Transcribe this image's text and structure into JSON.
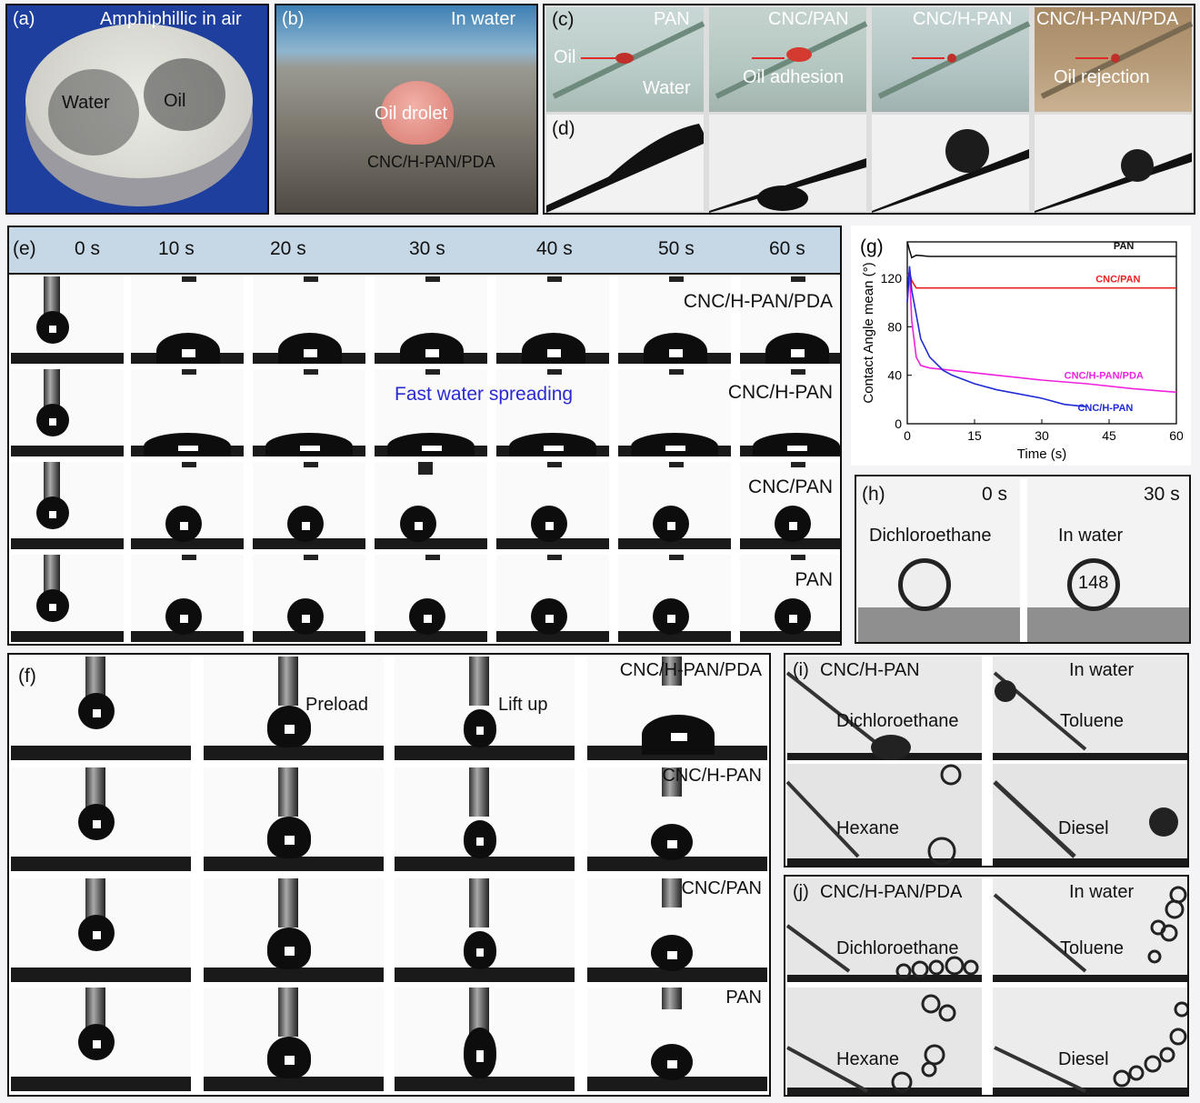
{
  "panels": {
    "a": {
      "label": "(a)",
      "title": "Amphiphillic in air",
      "water": "Water",
      "oil": "Oil"
    },
    "b": {
      "label": "(b)",
      "title": "In water",
      "droplet": "Oil drolet",
      "material": "CNC/H-PAN/PDA"
    },
    "c": {
      "label": "(c)",
      "titles": [
        "PAN",
        "CNC/PAN",
        "CNC/H-PAN",
        "CNC/H-PAN/PDA"
      ],
      "oil": "Oil",
      "water": "Water",
      "adhesion": "Oil adhesion",
      "rejection": "Oil rejection"
    },
    "d": {
      "label": "(d)"
    },
    "e": {
      "label": "(e)",
      "times": [
        "0 s",
        "10 s",
        "20 s",
        "30 s",
        "40 s",
        "50 s",
        "60 s"
      ],
      "rows": [
        "CNC/H-PAN/PDA",
        "CNC/H-PAN",
        "CNC/PAN",
        "PAN"
      ],
      "note": "Fast water spreading"
    },
    "f": {
      "label": "(f)",
      "rows": [
        "CNC/H-PAN/PDA",
        "CNC/H-PAN",
        "CNC/PAN",
        "PAN"
      ],
      "preload": "Preload",
      "liftup": "Lift up"
    },
    "h": {
      "label": "(h)",
      "t0": "0 s",
      "t30": "30 s",
      "left": "Dichloroethane",
      "right": "In water",
      "angle": "148"
    },
    "i": {
      "label": "(i)",
      "material": "CNC/H-PAN",
      "env": "In water",
      "oils": [
        "Dichloroethane",
        "Toluene",
        "Hexane",
        "Diesel"
      ]
    },
    "j": {
      "label": "(j)",
      "material": "CNC/H-PAN/PDA",
      "env": "In water",
      "oils": [
        "Dichloroethane",
        "Toluene",
        "Hexane",
        "Diesel"
      ]
    }
  },
  "chart_data": {
    "label": "(g)",
    "type": "line",
    "xlabel": "Time (s)",
    "ylabel": "Contact Angle mean (°)",
    "xlim": [
      0,
      60
    ],
    "ylim": [
      0,
      150
    ],
    "xticks": [
      0,
      15,
      30,
      45,
      60
    ],
    "yticks": [
      0,
      40,
      80,
      120
    ],
    "series": [
      {
        "name": "PAN",
        "color": "#111111",
        "x": [
          0,
          0.5,
          1,
          2,
          5,
          10,
          20,
          30,
          40,
          50,
          60
        ],
        "y": [
          150,
          143,
          137,
          139,
          138,
          138,
          138,
          138,
          138,
          138,
          138
        ]
      },
      {
        "name": "CNC/PAN",
        "color": "#e8231f",
        "x": [
          0,
          0.5,
          1,
          2,
          3,
          10,
          20,
          30,
          40,
          50,
          60
        ],
        "y": [
          122,
          125,
          118,
          112,
          112,
          112,
          112,
          112,
          112,
          112,
          112
        ]
      },
      {
        "name": "CNC/H-PAN/PDA",
        "color": "#ee22dd",
        "x": [
          0,
          0.5,
          1,
          2,
          3,
          5,
          10,
          20,
          30,
          40,
          50,
          60
        ],
        "y": [
          100,
          125,
          85,
          55,
          48,
          46,
          44,
          40,
          36,
          33,
          29,
          26
        ]
      },
      {
        "name": "CNC/H-PAN",
        "color": "#1f2bd6",
        "x": [
          0,
          0.5,
          1,
          2,
          3,
          5,
          8,
          10,
          15,
          20,
          30,
          35,
          40
        ],
        "y": [
          100,
          130,
          110,
          90,
          70,
          55,
          44,
          40,
          33,
          28,
          21,
          16,
          14
        ]
      }
    ]
  }
}
